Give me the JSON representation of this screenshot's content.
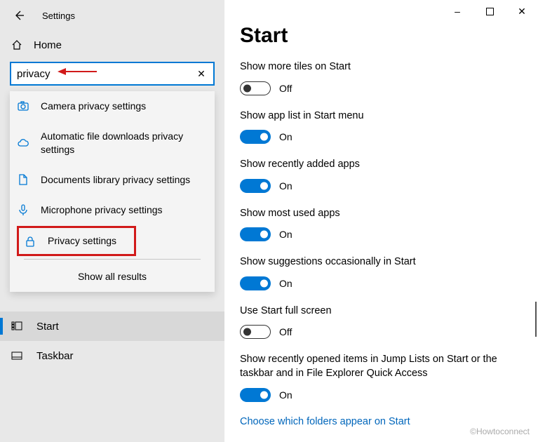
{
  "app_title": "Settings",
  "window_controls": {
    "min": "–",
    "max_icon": "□",
    "close": "✕"
  },
  "home_label": "Home",
  "search": {
    "value": "privacy",
    "clear_glyph": "✕"
  },
  "annotation_arrow_color": "#d11a1a",
  "suggestions": {
    "items": [
      {
        "icon": "camera-icon",
        "label": "Camera privacy settings"
      },
      {
        "icon": "cloud-icon",
        "label": "Automatic file downloads privacy settings"
      },
      {
        "icon": "document-icon",
        "label": "Documents library privacy settings"
      },
      {
        "icon": "microphone-icon",
        "label": "Microphone privacy settings"
      },
      {
        "icon": "lock-icon",
        "label": "Privacy settings",
        "highlight": true
      }
    ],
    "show_all_label": "Show all results"
  },
  "sidebar": {
    "items": [
      {
        "icon": "start-icon",
        "label": "Start",
        "active": true
      },
      {
        "icon": "taskbar-icon",
        "label": "Taskbar",
        "active": false
      }
    ]
  },
  "main": {
    "title": "Start",
    "settings": [
      {
        "label": "Show more tiles on Start",
        "on": false
      },
      {
        "label": "Show app list in Start menu",
        "on": true
      },
      {
        "label": "Show recently added apps",
        "on": true
      },
      {
        "label": "Show most used apps",
        "on": true
      },
      {
        "label": "Show suggestions occasionally in Start",
        "on": true
      },
      {
        "label": "Use Start full screen",
        "on": false
      },
      {
        "label": "Show recently opened items in Jump Lists on Start or the taskbar and in File Explorer Quick Access",
        "on": true
      }
    ],
    "link_label": "Choose which folders appear on Start",
    "state_on_label": "On",
    "state_off_label": "Off"
  },
  "watermark": "©Howtoconnect"
}
